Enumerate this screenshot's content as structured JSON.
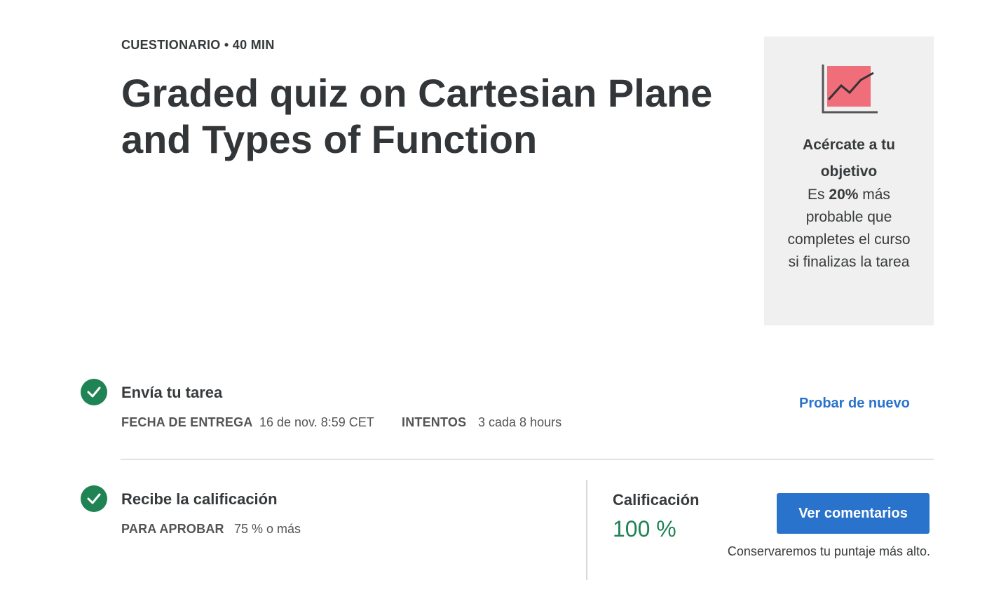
{
  "header": {
    "meta": "CUESTIONARIO • 40 MIN",
    "title": "Graded quiz on Cartesian Plane and Types of Function"
  },
  "goal_card": {
    "icon": "trend-chart-icon",
    "heading": "Acércate a tu objetivo",
    "body_prefix": "Es ",
    "body_emphasis": "20%",
    "body_suffix": " más probable que completes el curso si finalizas la tarea"
  },
  "submit_step": {
    "title": "Envía tu tarea",
    "due_label": "FECHA DE ENTREGA",
    "due_value": "16 de nov. 8:59 CET",
    "attempts_label": "INTENTOS",
    "attempts_value": "3 cada 8 hours",
    "retry_label": "Probar de nuevo"
  },
  "grade_step": {
    "title": "Recibe la calificación",
    "pass_label": "PARA APROBAR",
    "pass_value": "75 % o más",
    "grade_label": "Calificación",
    "grade_value": "100 %",
    "feedback_button": "Ver comentarios",
    "keep_note": "Conservaremos tu puntaje más alto."
  },
  "colors": {
    "success": "#1f8354",
    "accent": "#2a73cc",
    "chart_fill": "#f06d7a",
    "card_bg": "#f0f0f0"
  }
}
